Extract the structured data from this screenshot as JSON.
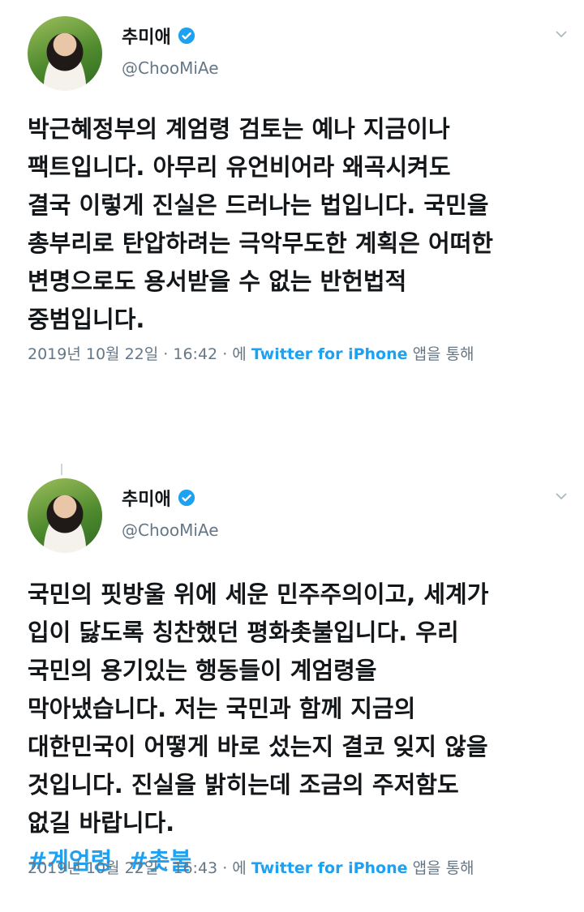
{
  "tweets": [
    {
      "author": {
        "name": "추미애",
        "handle": "@ChooMiAe",
        "verified": true
      },
      "lines": [
        "박근혜정부의 계엄령 검토는 예나 지금이나",
        "팩트입니다. 아무리 유언비어라 왜곡시켜도",
        "결국 이렇게 진실은 드러나는 법입니다. 국민을",
        "총부리로 탄압하려는 극악무도한 계획은 어떠한",
        "변명으로도 용서받을 수 없는 반헌법적",
        "중범입니다."
      ],
      "hashtags": [],
      "meta": {
        "date": "2019년 10월 22일",
        "time": "16:42",
        "via": "에",
        "source": "Twitter for iPhone",
        "suffix": "앱을 통해"
      }
    },
    {
      "author": {
        "name": "추미애",
        "handle": "@ChooMiAe",
        "verified": true
      },
      "lines": [
        "국민의 핏방울 위에 세운 민주주의이고, 세계가",
        "입이 닳도록 칭찬했던 평화촛불입니다. 우리",
        "국민의 용기있는 행동들이 계엄령을",
        "막아냈습니다. 저는 국민과 함께 지금의",
        "대한민국이 어떻게 바로 섰는지 결코 잊지 않을",
        "것입니다. 진실을 밝히는데 조금의 주저함도",
        "없길 바랍니다."
      ],
      "hashtags": [
        "#계엄령",
        "#촛불"
      ],
      "meta": {
        "date": "2019년 10월 22일",
        "time": "16:43",
        "via": "에",
        "source": "Twitter for iPhone",
        "suffix": "앱을 통해"
      }
    }
  ],
  "colors": {
    "link": "#1da1f2",
    "secondary_text": "#657786",
    "text": "#14171a"
  },
  "icons": {
    "verified": "verified-badge-icon",
    "menu": "chevron-down-icon"
  }
}
